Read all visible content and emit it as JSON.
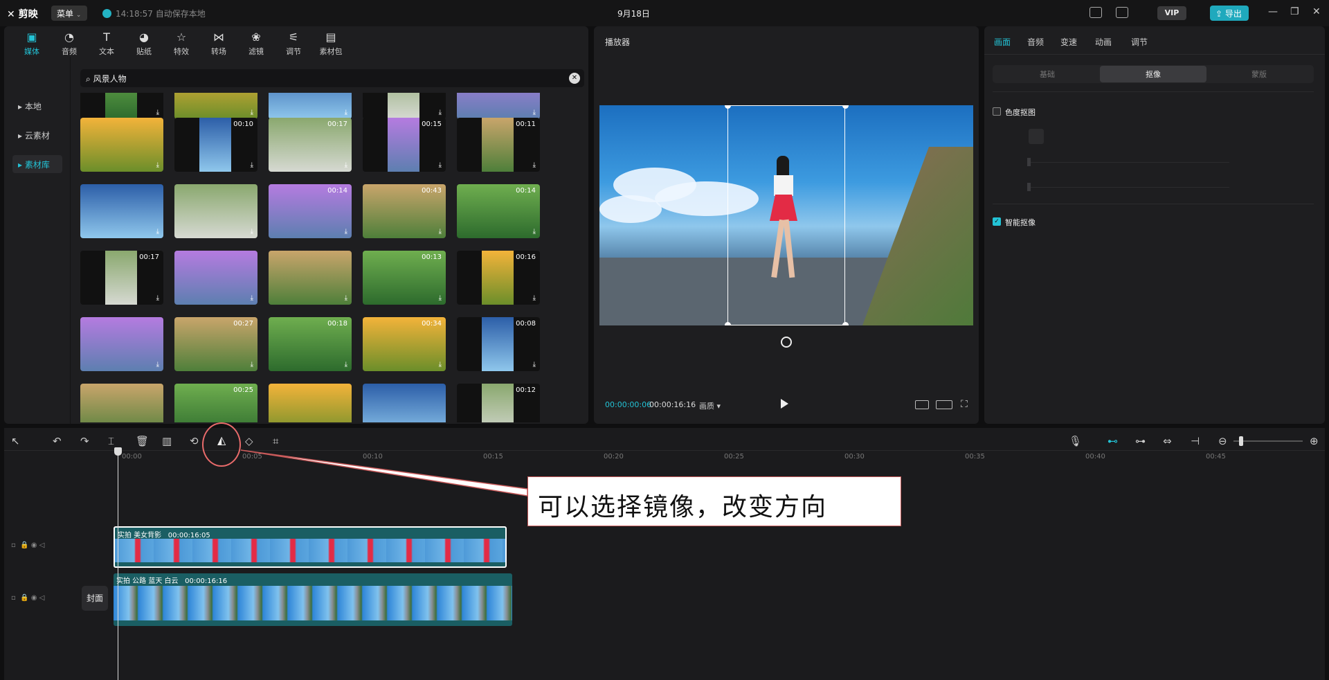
{
  "titlebar": {
    "app_name": "剪映",
    "menu_label": "菜单",
    "save_status": "14:18:57 自动保存本地",
    "project_title": "9月18日",
    "vip_label": "VIP",
    "export_label": "导出"
  },
  "media": {
    "tabs": [
      {
        "label": "媒体",
        "icon": "media-icon"
      },
      {
        "label": "音频",
        "icon": "audio-icon"
      },
      {
        "label": "文本",
        "icon": "text-icon"
      },
      {
        "label": "贴纸",
        "icon": "sticker-icon"
      },
      {
        "label": "特效",
        "icon": "effects-icon"
      },
      {
        "label": "转场",
        "icon": "transition-icon"
      },
      {
        "label": "滤镜",
        "icon": "filter-icon"
      },
      {
        "label": "调节",
        "icon": "adjust-icon"
      },
      {
        "label": "素材包",
        "icon": "package-icon"
      }
    ],
    "sidebar": [
      {
        "label": "本地"
      },
      {
        "label": "云素材"
      },
      {
        "label": "素材库"
      }
    ],
    "search_value": "风景人物",
    "durations": [
      [
        "",
        "",
        "",
        "",
        ""
      ],
      [
        "",
        "00:10",
        "00:17",
        "00:15",
        "00:11"
      ],
      [
        "",
        "",
        "00:14",
        "00:43",
        "00:14"
      ],
      [
        "00:17",
        "",
        "",
        "00:13",
        "00:16"
      ],
      [
        "",
        "00:27",
        "00:18",
        "00:34",
        "00:08"
      ],
      [
        "",
        "00:25",
        "",
        "",
        "00:12"
      ]
    ]
  },
  "player": {
    "title": "播放器",
    "current_time": "00:00:00:06",
    "total_time": "00:00:16:16",
    "quality_label": "画质"
  },
  "props": {
    "tabs": [
      "画面",
      "音频",
      "变速",
      "动画",
      "调节"
    ],
    "sub_tabs": [
      "基础",
      "抠像",
      "蒙版"
    ],
    "chroma_key_label": "色度抠图",
    "smart_cutout_label": "智能抠像"
  },
  "timeline": {
    "ruler": [
      "00:00",
      "00:05",
      "00:10",
      "00:15",
      "00:20",
      "00:25",
      "00:30",
      "00:35",
      "00:40",
      "00:45"
    ],
    "cover_label": "封面",
    "clip1": {
      "name": "实拍 美女背影",
      "duration": "00:00:16:05"
    },
    "clip2": {
      "name": "实拍 公路 蓝天 白云",
      "duration": "00:00:16:16"
    }
  },
  "annotation": {
    "text": "可以选择镜像，改变方向"
  },
  "colors": {
    "accent": "#23c3d6",
    "callout_border": "#e96b6b"
  }
}
